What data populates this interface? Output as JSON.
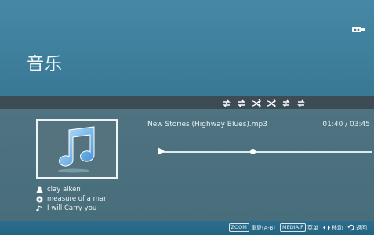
{
  "header": {
    "title": "音乐",
    "usb_icon": "usb-icon"
  },
  "controls": {
    "icons": [
      "repeat-one-icon",
      "repeat-icon",
      "shuffle-icon",
      "shuffle-repeat-icon",
      "repeat-all-icon",
      "repeat-off-icon"
    ]
  },
  "track": {
    "name": "New Stories (Highway Blues).mp3",
    "time": "01:40 / 03:45",
    "progress_fraction": 0.44
  },
  "album_art": {
    "icon": "music-note-icon"
  },
  "meta": {
    "artist": "clay alken",
    "album": "measure of a man",
    "title": "I will Carry you"
  },
  "footer": {
    "zoom_key": "ZOOM",
    "zoom_label": "重复(A-B)",
    "media_key": "MEDIA.P",
    "media_label": "菜单",
    "move_label": "移动",
    "back_label": "返回"
  },
  "colors": {
    "header": "#4688a5",
    "control_bar": "#3d4b55",
    "content": "#4f7380",
    "footer": "#2b6d8c"
  }
}
